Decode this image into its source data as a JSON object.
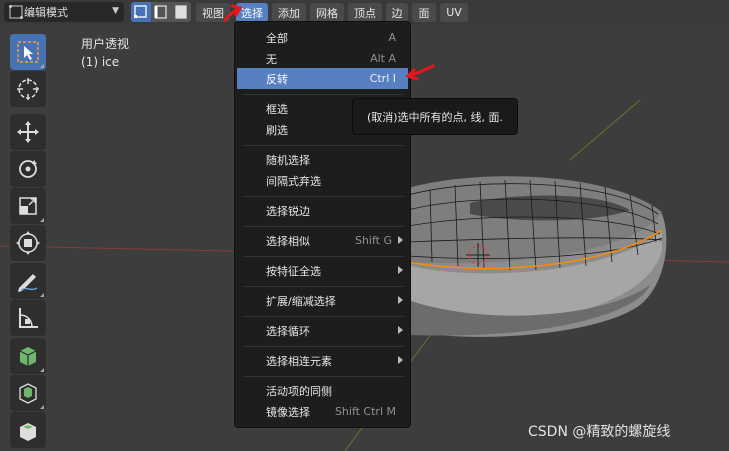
{
  "header": {
    "mode_label": "编辑模式",
    "menus": [
      {
        "label": "视图"
      },
      {
        "label": "选择",
        "active": true
      },
      {
        "label": "添加"
      },
      {
        "label": "网格"
      },
      {
        "label": "顶点"
      },
      {
        "label": "边"
      },
      {
        "label": "面"
      },
      {
        "label": "UV"
      }
    ]
  },
  "viewport": {
    "view_name": "用户透视",
    "object_name": "(1) ice"
  },
  "select_menu": {
    "items": [
      {
        "label": "全部",
        "shortcut": "A"
      },
      {
        "label": "无",
        "shortcut": "Alt A"
      },
      {
        "label": "反转",
        "shortcut": "Ctrl I",
        "highlighted": true
      },
      {
        "label": "框选",
        "shortcut": ""
      },
      {
        "label": "刷选",
        "shortcut": ""
      },
      {
        "label": "随机选择",
        "shortcut": ""
      },
      {
        "label": "间隔式弃选",
        "shortcut": ""
      },
      {
        "label": "选择锐边",
        "shortcut": ""
      },
      {
        "label": "选择相似",
        "shortcut": "Shift G",
        "submenu": true
      },
      {
        "label": "按特征全选",
        "shortcut": "",
        "submenu": true
      },
      {
        "label": "扩展/缩减选择",
        "shortcut": "",
        "submenu": true
      },
      {
        "label": "选择循环",
        "shortcut": "",
        "submenu": true
      },
      {
        "label": "选择相连元素",
        "shortcut": "",
        "submenu": true
      },
      {
        "label": "活动项的同侧",
        "shortcut": ""
      },
      {
        "label": "镜像选择",
        "shortcut": "Shift Ctrl M"
      }
    ]
  },
  "tooltip": {
    "text": "(取消)选中所有的点, 线, 面."
  },
  "watermark": {
    "text": "CSDN @精致的螺旋线"
  },
  "colors": {
    "accent": "#5680c2",
    "annotation_red": "#e8141e",
    "selected_vertex": "#ff8a00"
  }
}
